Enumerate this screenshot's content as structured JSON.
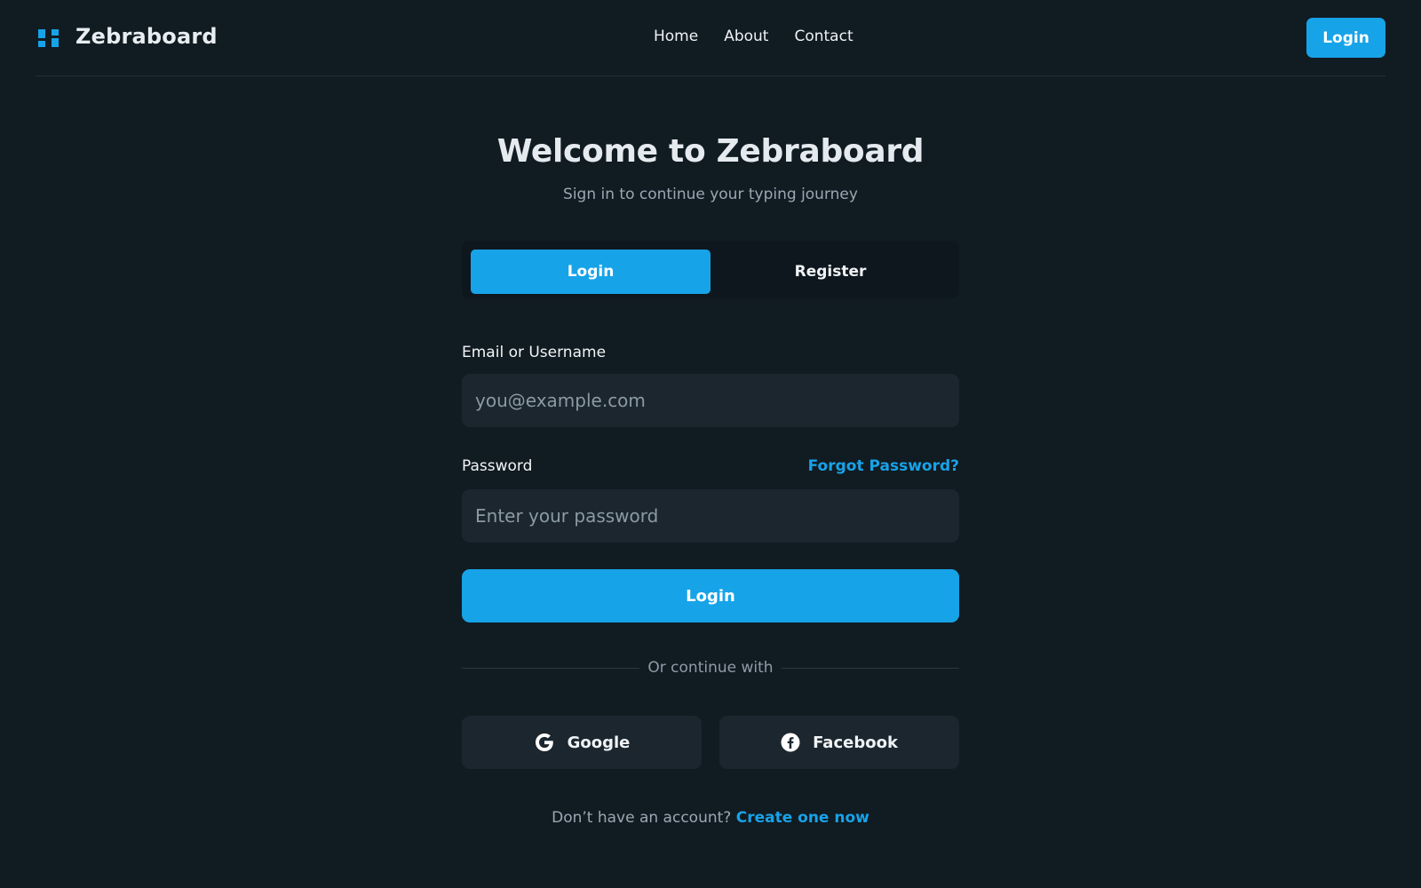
{
  "header": {
    "brand": "Zebraboard",
    "nav": [
      "Home",
      "About",
      "Contact"
    ],
    "login_label": "Login"
  },
  "main": {
    "title": "Welcome to Zebraboard",
    "subtitle": "Sign in to continue your typing journey",
    "tabs": [
      {
        "label": "Login",
        "active": true
      },
      {
        "label": "Register",
        "active": false
      }
    ],
    "email": {
      "label": "Email or Username",
      "placeholder": "you@example.com",
      "value": ""
    },
    "password": {
      "label": "Password",
      "placeholder": "Enter your password",
      "value": "",
      "forgot_label": "Forgot Password?"
    },
    "submit_label": "Login",
    "divider_text": "Or continue with",
    "social": [
      {
        "label": "Google",
        "icon": "google-icon"
      },
      {
        "label": "Facebook",
        "icon": "facebook-icon"
      }
    ],
    "signup_prompt": "Don’t have an account?",
    "signup_link": "Create one now"
  },
  "colors": {
    "background": "#111b22",
    "accent": "#17a3e8",
    "surface": "#1b262e",
    "text_muted": "#9aa8b3"
  }
}
